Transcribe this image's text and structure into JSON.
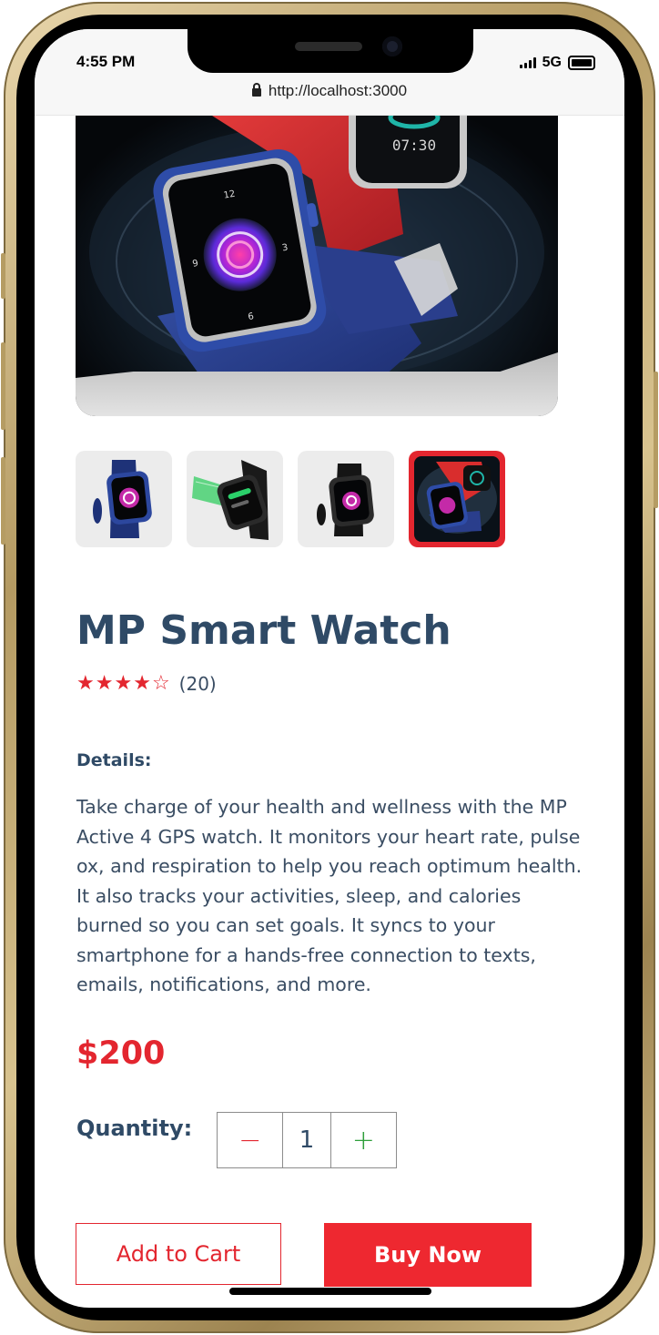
{
  "status_bar": {
    "time": "4:55 PM",
    "network": "5G",
    "url": "http://localhost:3000"
  },
  "product": {
    "title": "MP Smart Watch",
    "rating": 4,
    "rating_max": 5,
    "review_count": "(20)",
    "details_label": "Details:",
    "description": "Take charge of your health and wellness with the MP Active 4 GPS watch. It monitors your heart rate, pulse ox, and respiration to help you reach optimum health. It also tracks your activities, sleep, and calories burned so you can set goals. It syncs to your smartphone for a hands-free connection to texts, emails, notifications, and more.",
    "price": "$200",
    "quantity_label": "Quantity:",
    "quantity": "1",
    "minus_symbol": "−",
    "plus_symbol": "+"
  },
  "watch_face": {
    "time_display": "07:30"
  },
  "actions": {
    "add_to_cart": "Add to Cart",
    "buy_now": "Buy Now"
  },
  "thumbnails": [
    {
      "name": "blue-watch",
      "active": false
    },
    {
      "name": "black-watch-angled",
      "active": false
    },
    {
      "name": "black-watch",
      "active": false
    },
    {
      "name": "blue-red-watch-combo",
      "active": true
    }
  ],
  "colors": {
    "accent_red": "#e3262f",
    "heading_blue": "#2f4a66",
    "plus_green": "#2e9e3a"
  },
  "icons": {
    "lock": "lock-icon",
    "star_filled": "star-icon",
    "star_empty": "star-outline-icon"
  }
}
